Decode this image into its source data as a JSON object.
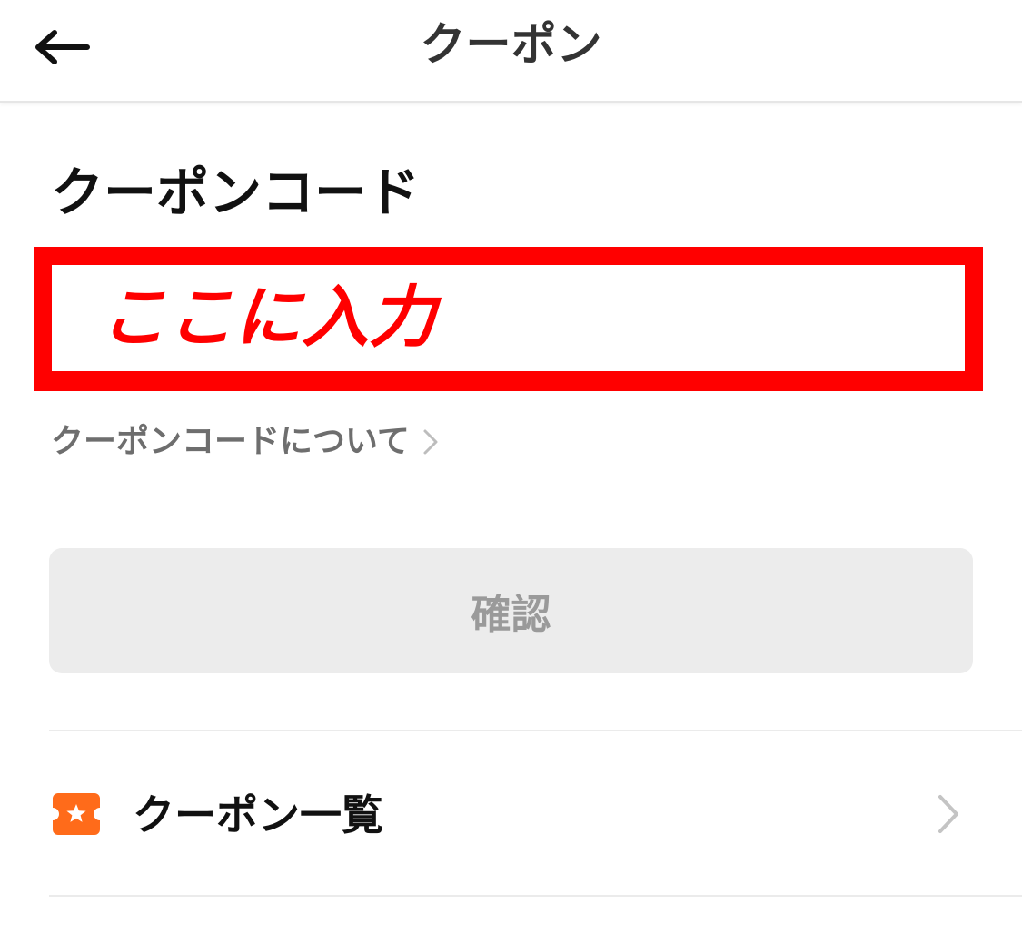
{
  "header": {
    "title": "クーポン",
    "back_icon": "arrow-left-icon"
  },
  "coupon_code": {
    "section_title": "クーポンコード",
    "input_value": "",
    "annotation_text": "ここに入力",
    "annotation_color": "#ff0000",
    "about_link": "クーポンコードについて"
  },
  "confirm_button": {
    "label": "確認"
  },
  "coupon_list": {
    "label": "クーポン一覧",
    "icon": "coupon-ticket-icon",
    "icon_color": "#ff6b1a"
  }
}
